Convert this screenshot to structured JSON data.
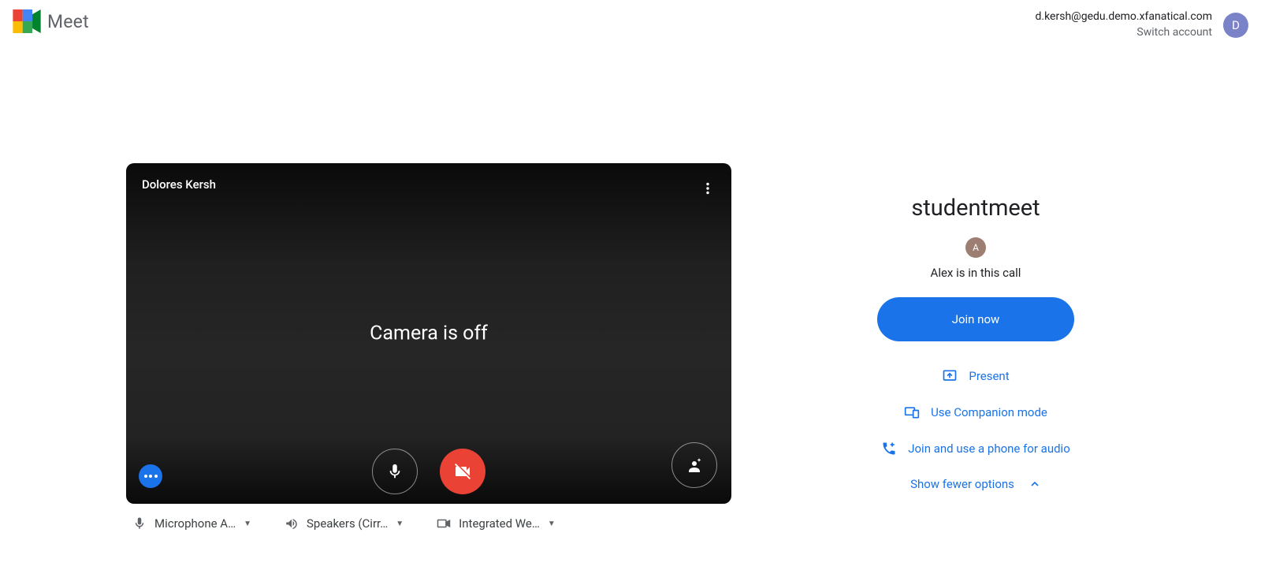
{
  "header": {
    "brand": "Meet",
    "account_email": "d.kersh@gedu.demo.xfanatical.com",
    "switch_account": "Switch account",
    "avatar_letter": "D"
  },
  "preview": {
    "self_name": "Dolores Kersh",
    "status_text": "Camera is off"
  },
  "devices": {
    "mic_label": "Microphone A…",
    "speaker_label": "Speakers (Cirr…",
    "camera_label": "Integrated We…"
  },
  "join": {
    "title": "studentmeet",
    "participant_initial": "A",
    "in_call_text": "Alex is in this call",
    "join_label": "Join now",
    "present_label": "Present",
    "companion_label": "Use Companion mode",
    "phone_label": "Join and use a phone for audio",
    "toggle_label": "Show fewer options"
  },
  "colors": {
    "primary": "#1a73e8",
    "danger": "#ea4335"
  }
}
